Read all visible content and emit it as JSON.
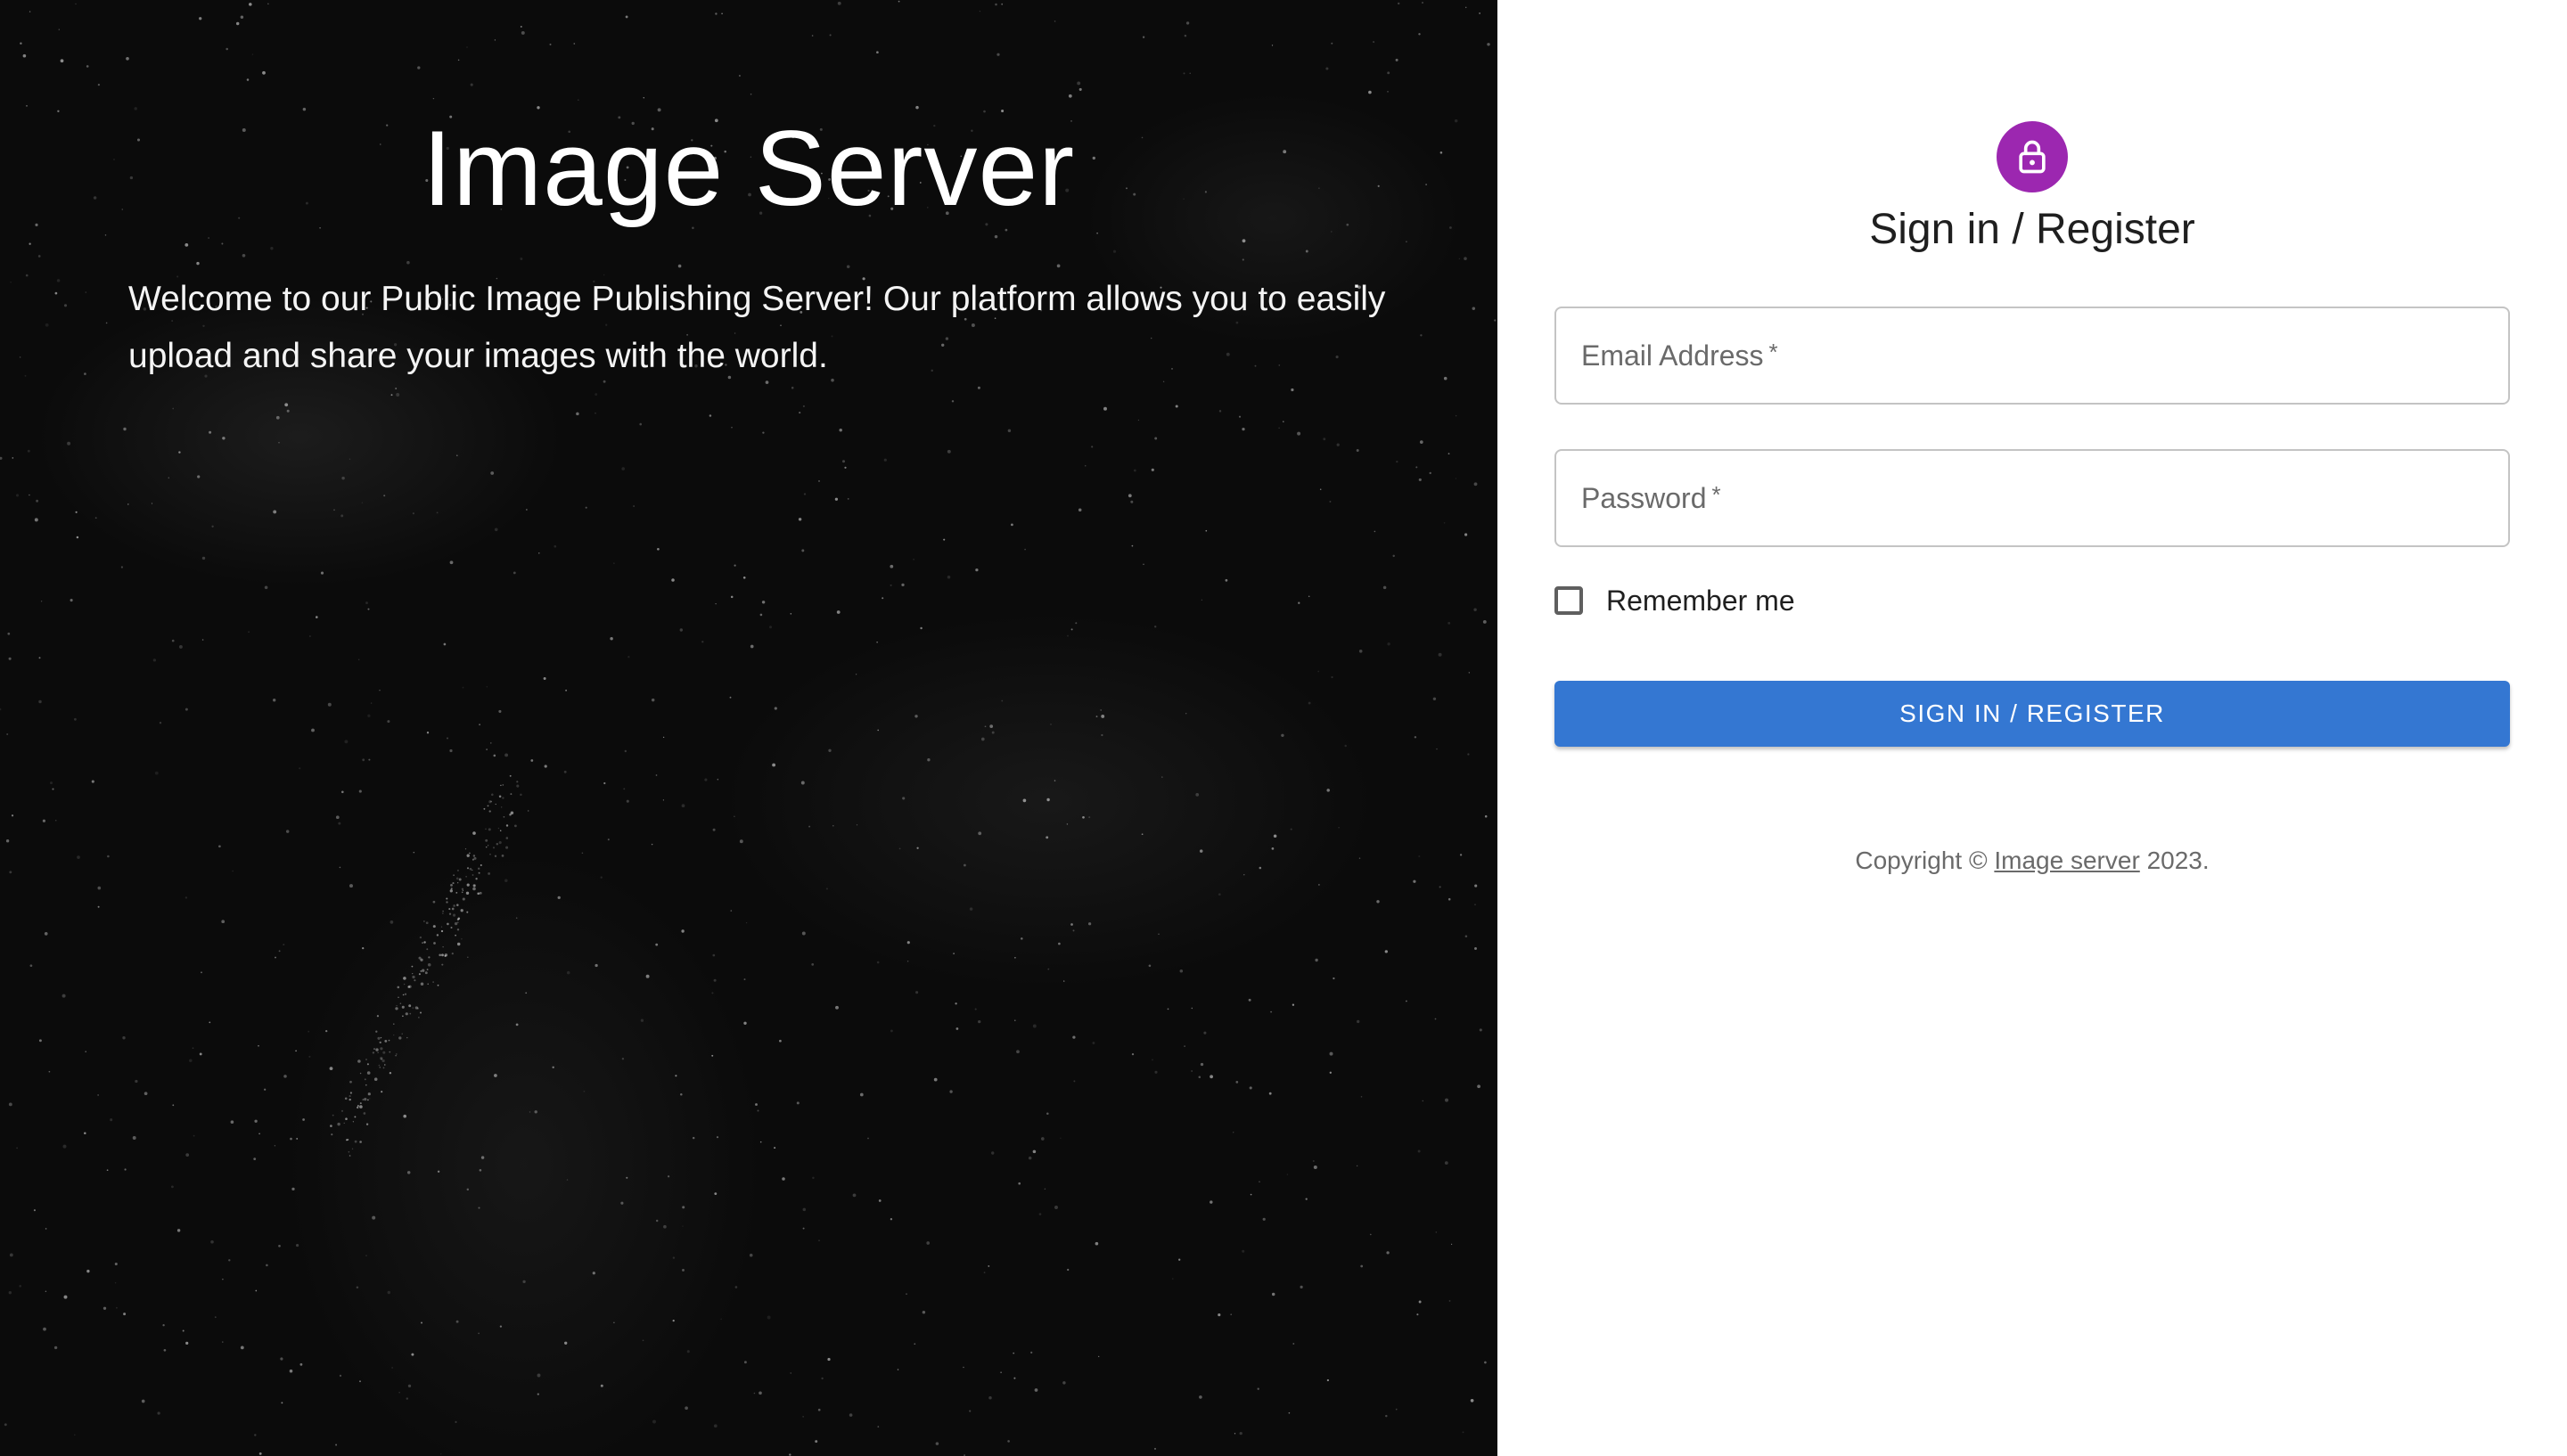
{
  "hero": {
    "title": "Image Server",
    "description": "Welcome to our Public Image Publishing Server! Our platform allows you to easily upload and share your images with the world."
  },
  "form": {
    "icon": "lock-icon",
    "title": "Sign in / Register",
    "email_label": "Email Address",
    "password_label": "Password",
    "required_mark": "*",
    "email_value": "",
    "password_value": "",
    "remember_label": "Remember me",
    "remember_checked": false,
    "submit_label": "SIGN IN / REGISTER"
  },
  "footer": {
    "copyright_prefix": "Copyright ©",
    "link_text": "Image server",
    "year_suffix": "2023."
  },
  "colors": {
    "accent": "#9c27b0",
    "primary": "#3477d2",
    "hero_background": "#0b0b0b"
  }
}
